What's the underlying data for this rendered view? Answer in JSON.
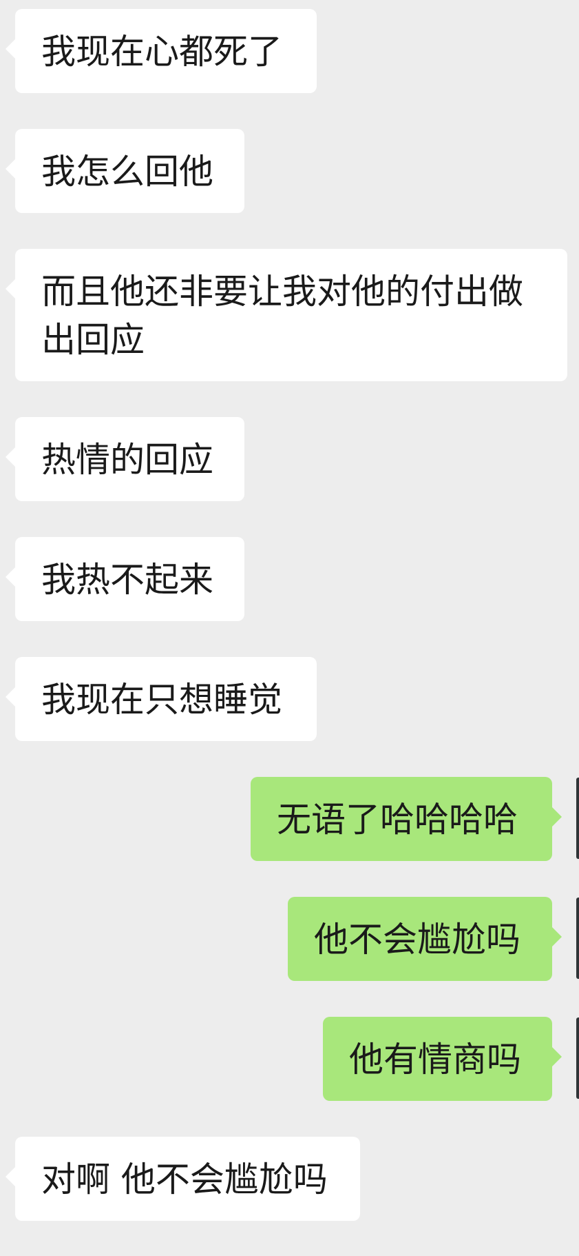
{
  "messages": [
    {
      "side": "in",
      "text": "我现在心都死了"
    },
    {
      "side": "in",
      "text": "我怎么回他"
    },
    {
      "side": "in",
      "text": "而且他还非要让我对他的付出做出回应"
    },
    {
      "side": "in",
      "text": "热情的回应"
    },
    {
      "side": "in",
      "text": "我热不起来"
    },
    {
      "side": "in",
      "text": "我现在只想睡觉"
    },
    {
      "side": "out",
      "text": "无语了哈哈哈哈"
    },
    {
      "side": "out",
      "text": "他不会尴尬吗"
    },
    {
      "side": "out",
      "text": "他有情商吗"
    },
    {
      "side": "in",
      "text": "对啊 他不会尴尬吗"
    }
  ]
}
